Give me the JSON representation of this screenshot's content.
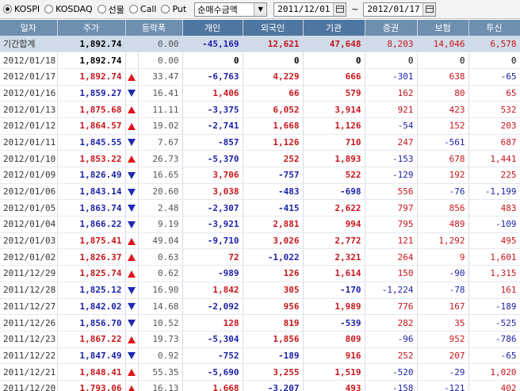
{
  "toolbar": {
    "markets": [
      {
        "label": "KOSPI",
        "selected": true
      },
      {
        "label": "KOSDAQ",
        "selected": false
      },
      {
        "label": "선물",
        "selected": false
      },
      {
        "label": "Call",
        "selected": false
      },
      {
        "label": "Put",
        "selected": false
      }
    ],
    "metric": "순매수금액",
    "date_from": "2011/12/01",
    "tilde": "~",
    "date_to": "2012/01/17"
  },
  "columns": [
    "일자",
    "주가",
    "등락폭",
    "개인",
    "외국인",
    "기관",
    "증권",
    "보험",
    "투신"
  ],
  "summary": {
    "date": "기간합계",
    "price": "1,892.74",
    "chg": "0.00",
    "ind": "-45,169",
    "frn": "12,621",
    "inst": "47,648",
    "sec": "8,203",
    "ins": "14,046",
    "trust": "6,578"
  },
  "rows": [
    {
      "date": "2012/01/18",
      "price": "1,892.74",
      "dir": "",
      "chg": "0.00",
      "ind": "0",
      "frn": "0",
      "inst": "0",
      "sec": "0",
      "ins": "0",
      "trust": "0"
    },
    {
      "date": "2012/01/17",
      "price": "1,892.74",
      "dir": "up",
      "chg": "33.47",
      "ind": "-6,763",
      "frn": "4,229",
      "inst": "666",
      "sec": "-301",
      "ins": "638",
      "trust": "-65"
    },
    {
      "date": "2012/01/16",
      "price": "1,859.27",
      "dir": "down",
      "chg": "16.41",
      "ind": "1,406",
      "frn": "66",
      "inst": "579",
      "sec": "162",
      "ins": "80",
      "trust": "65"
    },
    {
      "date": "2012/01/13",
      "price": "1,875.68",
      "dir": "up",
      "chg": "11.11",
      "ind": "-3,375",
      "frn": "6,052",
      "inst": "3,914",
      "sec": "921",
      "ins": "423",
      "trust": "532"
    },
    {
      "date": "2012/01/12",
      "price": "1,864.57",
      "dir": "up",
      "chg": "19.02",
      "ind": "-2,741",
      "frn": "1,668",
      "inst": "1,126",
      "sec": "-54",
      "ins": "152",
      "trust": "203"
    },
    {
      "date": "2012/01/11",
      "price": "1,845.55",
      "dir": "down",
      "chg": "7.67",
      "ind": "-857",
      "frn": "1,126",
      "inst": "710",
      "sec": "247",
      "ins": "-561",
      "trust": "687"
    },
    {
      "date": "2012/01/10",
      "price": "1,853.22",
      "dir": "up",
      "chg": "26.73",
      "ind": "-5,370",
      "frn": "252",
      "inst": "1,893",
      "sec": "-153",
      "ins": "678",
      "trust": "1,441"
    },
    {
      "date": "2012/01/09",
      "price": "1,826.49",
      "dir": "down",
      "chg": "16.65",
      "ind": "3,706",
      "frn": "-757",
      "inst": "522",
      "sec": "-129",
      "ins": "192",
      "trust": "225"
    },
    {
      "date": "2012/01/06",
      "price": "1,843.14",
      "dir": "down",
      "chg": "20.60",
      "ind": "3,038",
      "frn": "-483",
      "inst": "-698",
      "sec": "556",
      "ins": "-76",
      "trust": "-1,199"
    },
    {
      "date": "2012/01/05",
      "price": "1,863.74",
      "dir": "down",
      "chg": "2.48",
      "ind": "-2,307",
      "frn": "-415",
      "inst": "2,622",
      "sec": "797",
      "ins": "856",
      "trust": "483"
    },
    {
      "date": "2012/01/04",
      "price": "1,866.22",
      "dir": "down",
      "chg": "9.19",
      "ind": "-3,921",
      "frn": "2,881",
      "inst": "994",
      "sec": "795",
      "ins": "489",
      "trust": "-109"
    },
    {
      "date": "2012/01/03",
      "price": "1,875.41",
      "dir": "up",
      "chg": "49.04",
      "ind": "-9,710",
      "frn": "3,026",
      "inst": "2,772",
      "sec": "121",
      "ins": "1,292",
      "trust": "495"
    },
    {
      "date": "2012/01/02",
      "price": "1,826.37",
      "dir": "up",
      "chg": "0.63",
      "ind": "72",
      "frn": "-1,022",
      "inst": "2,321",
      "sec": "264",
      "ins": "9",
      "trust": "1,601"
    },
    {
      "date": "2011/12/29",
      "price": "1,825.74",
      "dir": "up",
      "chg": "0.62",
      "ind": "-989",
      "frn": "126",
      "inst": "1,614",
      "sec": "150",
      "ins": "-90",
      "trust": "1,315"
    },
    {
      "date": "2011/12/28",
      "price": "1,825.12",
      "dir": "down",
      "chg": "16.90",
      "ind": "1,842",
      "frn": "305",
      "inst": "-170",
      "sec": "-1,224",
      "ins": "-78",
      "trust": "161"
    },
    {
      "date": "2011/12/27",
      "price": "1,842.02",
      "dir": "down",
      "chg": "14.68",
      "ind": "-2,092",
      "frn": "956",
      "inst": "1,989",
      "sec": "776",
      "ins": "167",
      "trust": "-189"
    },
    {
      "date": "2011/12/26",
      "price": "1,856.70",
      "dir": "down",
      "chg": "10.52",
      "ind": "128",
      "frn": "819",
      "inst": "-539",
      "sec": "282",
      "ins": "35",
      "trust": "-525"
    },
    {
      "date": "2011/12/23",
      "price": "1,867.22",
      "dir": "up",
      "chg": "19.73",
      "ind": "-5,304",
      "frn": "1,856",
      "inst": "809",
      "sec": "-96",
      "ins": "952",
      "trust": "-786"
    },
    {
      "date": "2011/12/22",
      "price": "1,847.49",
      "dir": "down",
      "chg": "0.92",
      "ind": "-752",
      "frn": "-189",
      "inst": "916",
      "sec": "252",
      "ins": "207",
      "trust": "-65"
    },
    {
      "date": "2011/12/21",
      "price": "1,848.41",
      "dir": "up",
      "chg": "55.35",
      "ind": "-5,690",
      "frn": "3,255",
      "inst": "1,519",
      "sec": "-520",
      "ins": "-29",
      "trust": "1,020"
    },
    {
      "date": "2011/12/20",
      "price": "1,793.06",
      "dir": "up",
      "chg": "16.13",
      "ind": "1,668",
      "frn": "-3,207",
      "inst": "493",
      "sec": "-158",
      "ins": "-121",
      "trust": "402"
    }
  ],
  "colors": {
    "up": "#c8151b",
    "down": "#1b1fa8",
    "header": "#6e8fb0",
    "summary": "#cfdbe9"
  }
}
